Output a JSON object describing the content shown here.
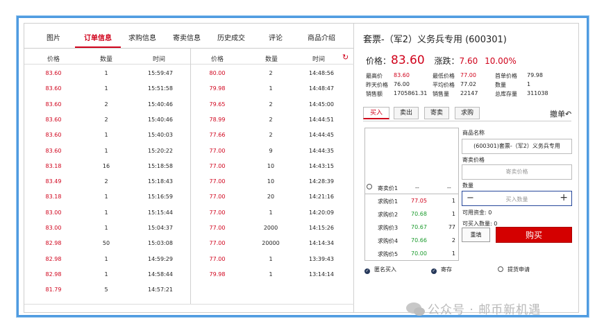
{
  "tabs": [
    "图片",
    "订单信息",
    "求购信息",
    "寄卖信息",
    "历史成交",
    "评论",
    "商品介绍"
  ],
  "orders": {
    "headers": [
      "价格",
      "数量",
      "时间"
    ],
    "left": [
      [
        "83.60",
        "1",
        "15:59:47"
      ],
      [
        "83.60",
        "1",
        "15:51:58"
      ],
      [
        "83.60",
        "2",
        "15:40:46"
      ],
      [
        "83.60",
        "2",
        "15:40:46"
      ],
      [
        "83.60",
        "1",
        "15:40:03"
      ],
      [
        "83.60",
        "1",
        "15:20:22"
      ],
      [
        "83.18",
        "16",
        "15:18:58"
      ],
      [
        "83.49",
        "2",
        "15:18:43"
      ],
      [
        "83.18",
        "1",
        "15:16:59"
      ],
      [
        "83.00",
        "1",
        "15:15:44"
      ],
      [
        "83.00",
        "1",
        "15:04:37"
      ],
      [
        "82.98",
        "50",
        "15:03:08"
      ],
      [
        "82.98",
        "1",
        "14:59:29"
      ],
      [
        "82.98",
        "1",
        "14:58:44"
      ],
      [
        "81.79",
        "5",
        "14:57:21"
      ]
    ],
    "right": [
      [
        "80.00",
        "2",
        "14:48:56"
      ],
      [
        "79.98",
        "1",
        "14:48:47"
      ],
      [
        "79.65",
        "2",
        "14:45:00"
      ],
      [
        "78.99",
        "2",
        "14:44:51"
      ],
      [
        "77.66",
        "2",
        "14:44:45"
      ],
      [
        "77.00",
        "9",
        "14:44:35"
      ],
      [
        "77.00",
        "10",
        "14:43:15"
      ],
      [
        "77.00",
        "10",
        "14:28:39"
      ],
      [
        "77.00",
        "20",
        "14:21:16"
      ],
      [
        "77.00",
        "1",
        "14:20:09"
      ],
      [
        "77.00",
        "2000",
        "14:15:26"
      ],
      [
        "77.00",
        "20000",
        "14:14:34"
      ],
      [
        "77.00",
        "1",
        "13:39:43"
      ],
      [
        "79.98",
        "1",
        "13:14:14"
      ]
    ]
  },
  "product": {
    "title": "套票-（军2）义务兵专用 (600301)",
    "price_label": "价格：",
    "price": "83.60",
    "change_label": "涨跌：",
    "change": "7.60",
    "change_pct": "10.00%",
    "stats": [
      [
        "最高价",
        "83.60",
        "最低价格",
        "77.00",
        "首单价格",
        "79.98"
      ],
      [
        "昨天价格",
        "76.00",
        "平均价格",
        "77.02",
        "数量",
        "1"
      ],
      [
        "销售额",
        "1705861.31",
        "销售量",
        "22147",
        "总库存量",
        "311038"
      ]
    ]
  },
  "trade": {
    "tabs": [
      "买入",
      "卖出",
      "寄卖",
      "求购"
    ],
    "cancel": "撤单",
    "ask_label": "寄卖价1",
    "ask_values": [
      "--",
      "--"
    ],
    "bids": [
      [
        "求购价1",
        "77.05",
        "1"
      ],
      [
        "求购价2",
        "70.68",
        "1"
      ],
      [
        "求购价3",
        "70.67",
        "77"
      ],
      [
        "求购价4",
        "70.66",
        "2"
      ],
      [
        "求购价5",
        "70.00",
        "1"
      ]
    ],
    "name_label": "商品名称",
    "name_value": "(600301)套票-（军2）义务兵专用",
    "price_label": "寄卖价格",
    "price_placeholder": "寄卖价格",
    "qty_label": "数量",
    "qty_placeholder": "买入数量",
    "minus": "−",
    "plus": "+",
    "funds": "可用资金: 0",
    "buyable": "可买入数量: 0",
    "fill_btn": "重填",
    "buy_btn": "购买",
    "options": [
      "匿名买入",
      "寄存",
      "提货申请"
    ]
  },
  "watermark": "公众号 · 邮币新机遇"
}
